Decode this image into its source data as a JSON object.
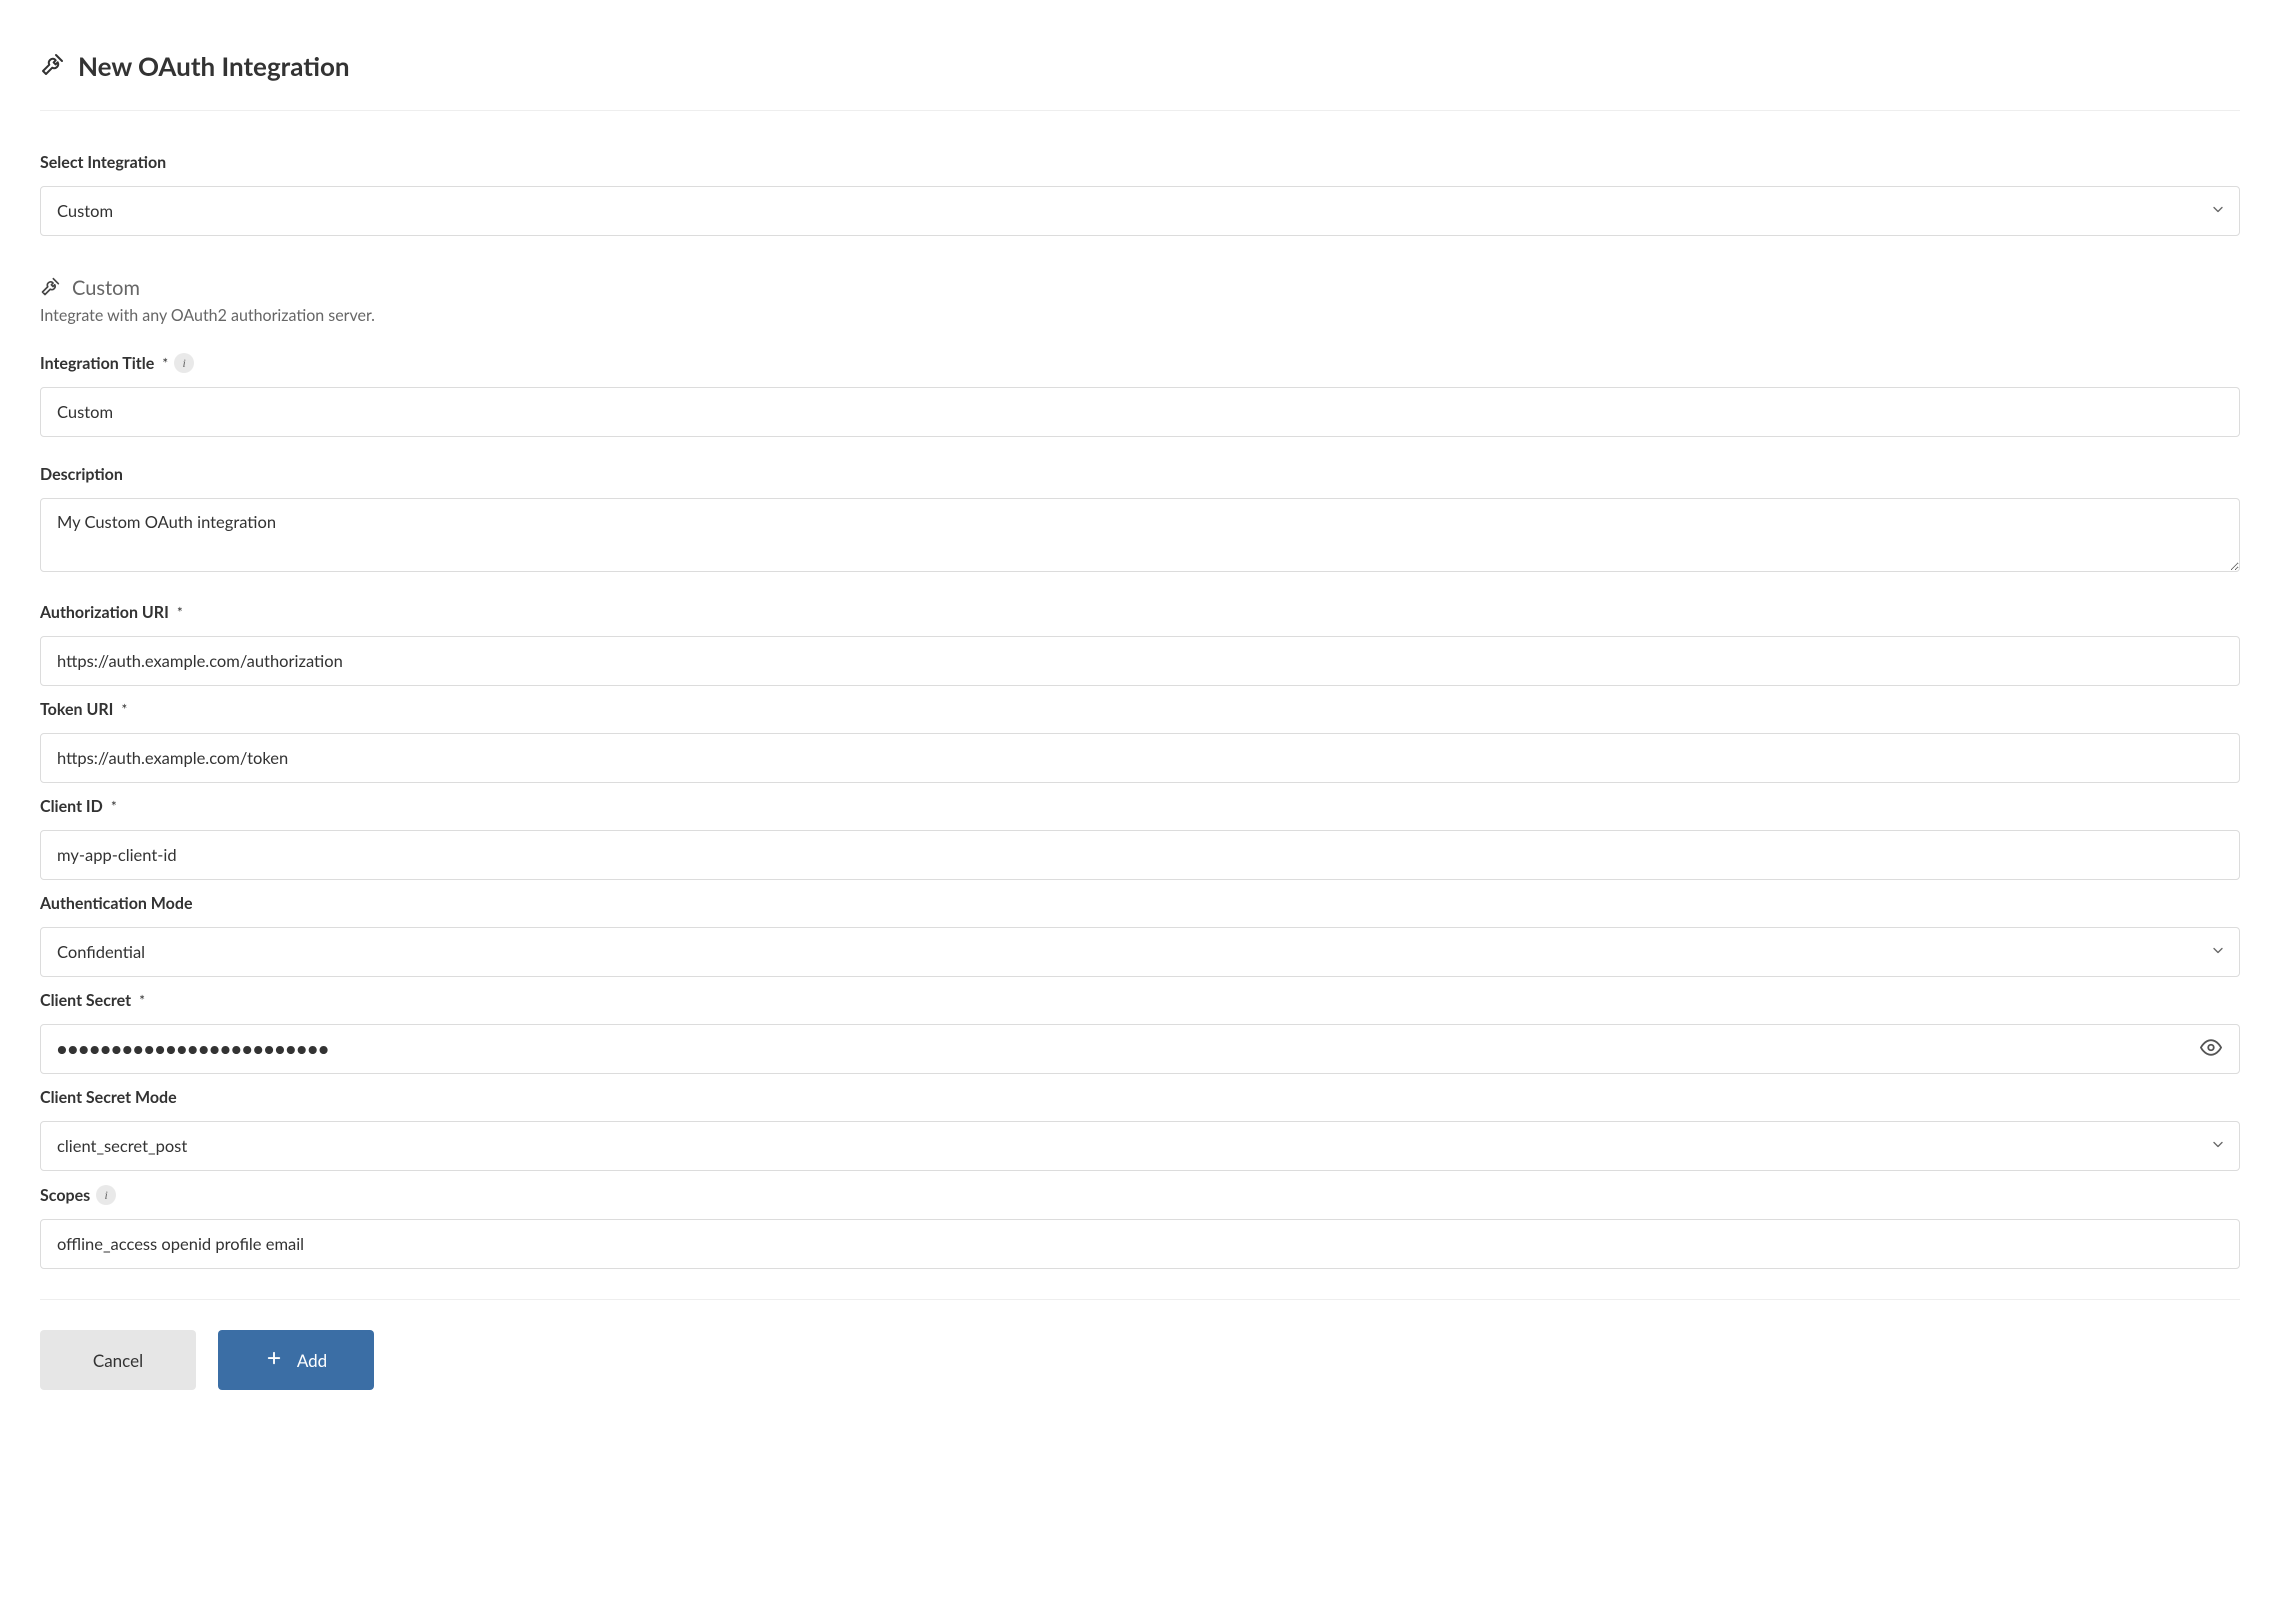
{
  "header": {
    "title": "New OAuth Integration"
  },
  "form": {
    "select_integration": {
      "label": "Select Integration",
      "value": "Custom"
    },
    "selected_integration": {
      "name": "Custom",
      "description": "Integrate with any OAuth2 authorization server."
    },
    "integration_title": {
      "label": "Integration Title",
      "value": "Custom"
    },
    "description": {
      "label": "Description",
      "value": "My Custom OAuth integration"
    },
    "authorization_uri": {
      "label": "Authorization URI",
      "value": "https://auth.example.com/authorization"
    },
    "token_uri": {
      "label": "Token URI",
      "value": "https://auth.example.com/token"
    },
    "client_id": {
      "label": "Client ID",
      "value": "my-app-client-id"
    },
    "authentication_mode": {
      "label": "Authentication Mode",
      "value": "Confidential"
    },
    "client_secret": {
      "label": "Client Secret",
      "value": "●●●●●●●●●●●●●●●●●●●●●●●●●"
    },
    "client_secret_mode": {
      "label": "Client Secret Mode",
      "value": "client_secret_post"
    },
    "scopes": {
      "label": "Scopes",
      "value": "offline_access openid profile email"
    }
  },
  "actions": {
    "cancel": "Cancel",
    "add": "Add"
  },
  "info_glyph": "i"
}
